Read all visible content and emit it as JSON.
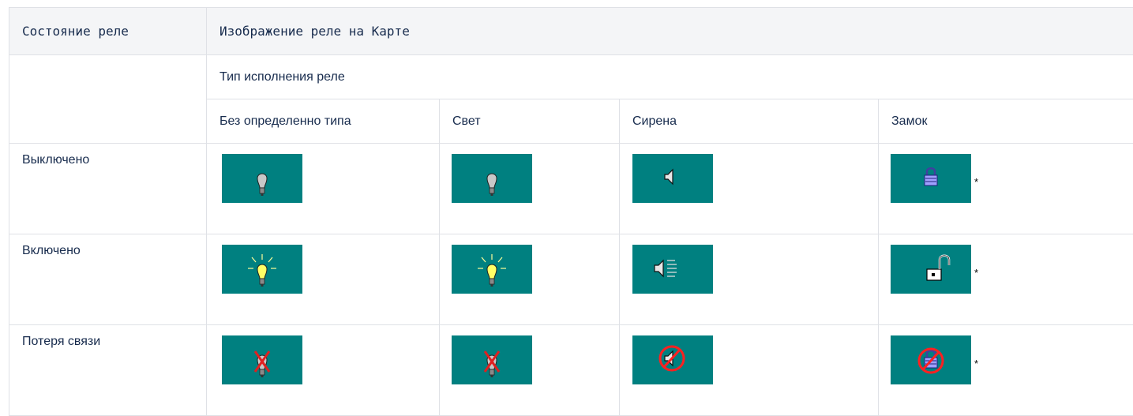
{
  "header": {
    "state_col": "Состояние реле",
    "image_col": "Изображение реле на Карте"
  },
  "type_header": "Тип исполнения реле",
  "types": [
    "Без определенно типа",
    "Свет",
    "Сирена",
    "Замок"
  ],
  "rows": [
    {
      "state": "Выключено",
      "icons": [
        "bulb-off-icon",
        "bulb-off-icon",
        "speaker-off-icon",
        "lock-closed-icon"
      ],
      "lock_note": "*"
    },
    {
      "state": "Включено",
      "icons": [
        "bulb-on-icon",
        "bulb-on-icon",
        "speaker-on-icon",
        "lock-open-icon"
      ],
      "lock_note": "*"
    },
    {
      "state": "Потеря связи",
      "icons": [
        "bulb-lost-icon",
        "bulb-lost-icon",
        "speaker-lost-icon",
        "lock-lost-icon"
      ],
      "lock_note": "*"
    }
  ],
  "colors": {
    "tile_background": "#008080",
    "header_background": "#f4f5f7",
    "border": "#dfe1e6"
  }
}
